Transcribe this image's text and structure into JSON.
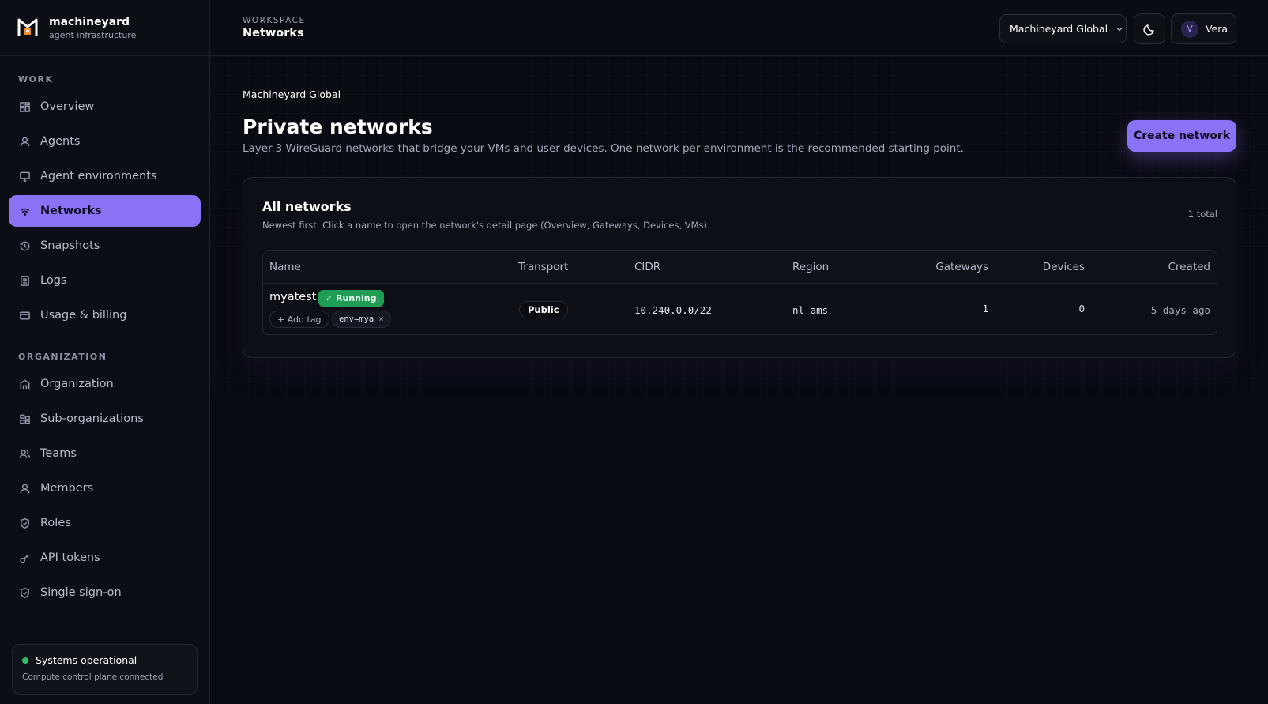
{
  "brand": {
    "name": "machineyard",
    "subtitle": "agent infrastructure"
  },
  "sidebar": {
    "work_label": "WORK",
    "work_items": [
      {
        "label": "Overview",
        "icon": "grid-icon"
      },
      {
        "label": "Agents",
        "icon": "user-icon"
      },
      {
        "label": "Agent environments",
        "icon": "monitor-icon"
      },
      {
        "label": "Networks",
        "icon": "wifi-icon",
        "active": true
      },
      {
        "label": "Snapshots",
        "icon": "history-icon"
      },
      {
        "label": "Logs",
        "icon": "document-icon"
      },
      {
        "label": "Usage & billing",
        "icon": "card-icon"
      }
    ],
    "org_label": "ORGANIZATION",
    "org_items": [
      {
        "label": "Organization",
        "icon": "building-icon"
      },
      {
        "label": "Sub-organizations",
        "icon": "hierarchy-icon"
      },
      {
        "label": "Teams",
        "icon": "users-icon"
      },
      {
        "label": "Members",
        "icon": "person-icon"
      },
      {
        "label": "Roles",
        "icon": "shield-icon"
      },
      {
        "label": "API tokens",
        "icon": "key-icon"
      },
      {
        "label": "Single sign-on",
        "icon": "shield-check-icon"
      }
    ],
    "status": {
      "title": "Systems operational",
      "subtitle": "Compute control plane connected",
      "color": "#2fbe6a"
    }
  },
  "topbar": {
    "section": "WORKSPACE",
    "title": "Networks",
    "org_select": "Machineyard Global",
    "user": {
      "initial": "V",
      "name": "Vera"
    }
  },
  "main": {
    "org_label": "Machineyard Global",
    "title": "Private networks",
    "description": "Layer-3 WireGuard networks that bridge your VMs and user devices. One network per environment is the recommended starting point.",
    "create_button": "Create network",
    "card": {
      "title": "All networks",
      "subtitle": "Newest first. Click a name to open the network's detail page (Overview, Gateways, Devices, VMs).",
      "count": "1 total",
      "columns": [
        "Name",
        "Transport",
        "CIDR",
        "Region",
        "Gateways",
        "Devices",
        "Created"
      ],
      "rows": [
        {
          "name": "myatest",
          "status": "✓ Running",
          "add_tag": "+ Add tag",
          "tag": "env=mya",
          "transport": "Public",
          "cidr": "10.240.0.0/22",
          "region": "nl-ams",
          "gateways": "1",
          "devices": "0",
          "created": "5 days ago"
        }
      ]
    }
  },
  "colors": {
    "accent": "#8b72f5",
    "running": "#1f9d55",
    "background": "#090b12"
  }
}
